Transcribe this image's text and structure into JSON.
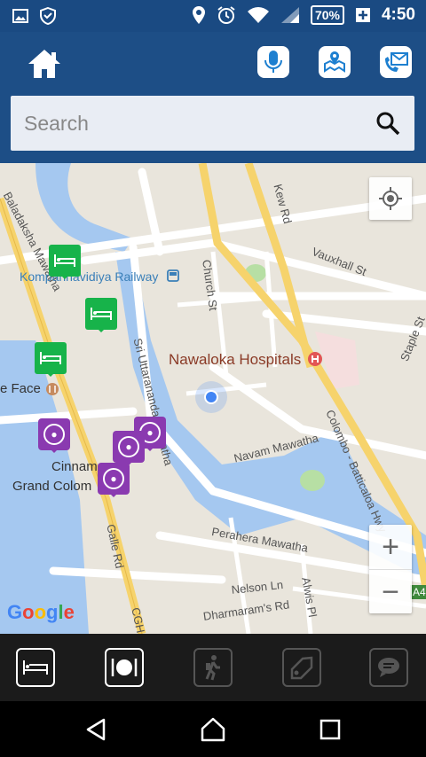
{
  "status_bar": {
    "battery": "70%",
    "time": "4:50"
  },
  "header": {
    "search": {
      "placeholder": "Search",
      "value": ""
    }
  },
  "map": {
    "labels": {
      "baladaksha": "Baladaksha Mawatha",
      "railway": "Kompannavidiya Railway",
      "church": "Church St",
      "kew": "Kew Rd",
      "vauxhall": "Vauxhall St",
      "uttarananda": "Sri Uttarananda Mawatha",
      "hospital": "Nawaloka Hospitals",
      "face": "e Face",
      "staple": "Staple St",
      "navam": "Navam Mawatha",
      "colombo": "Colombo - Batticaloa Hwy",
      "cinnamon1": "Cinnam",
      "cinnamon2": "Grand Colom",
      "galle": "Galle Rd",
      "perahera": "Perahera Mawatha",
      "nelson": "Nelson Ln",
      "alwis": "Alwis Pl",
      "dharmaram": "Dharmaram's Rd",
      "a4": "A4",
      "cgh": "CGH"
    },
    "google": "Google",
    "zoom_in": "+",
    "zoom_out": "−"
  },
  "colors": {
    "header_bg": "#1d4e86",
    "status_bg": "#1a4a82",
    "hotel_pin": "#17b34a",
    "restaurant_pin": "#8a3ab0",
    "water": "#a5c8f0",
    "main_road": "#f6d36c"
  },
  "icons": {
    "home": "home-icon",
    "mic": "mic-icon",
    "location": "map-location-icon",
    "mail": "phone-mail-icon",
    "search": "search-icon",
    "locate": "my-location-icon",
    "hotel": "bed-icon",
    "restaurant": "plate-cutlery-icon",
    "hiking": "hiker-icon",
    "tag": "price-tag-icon",
    "chat": "chat-icon"
  }
}
